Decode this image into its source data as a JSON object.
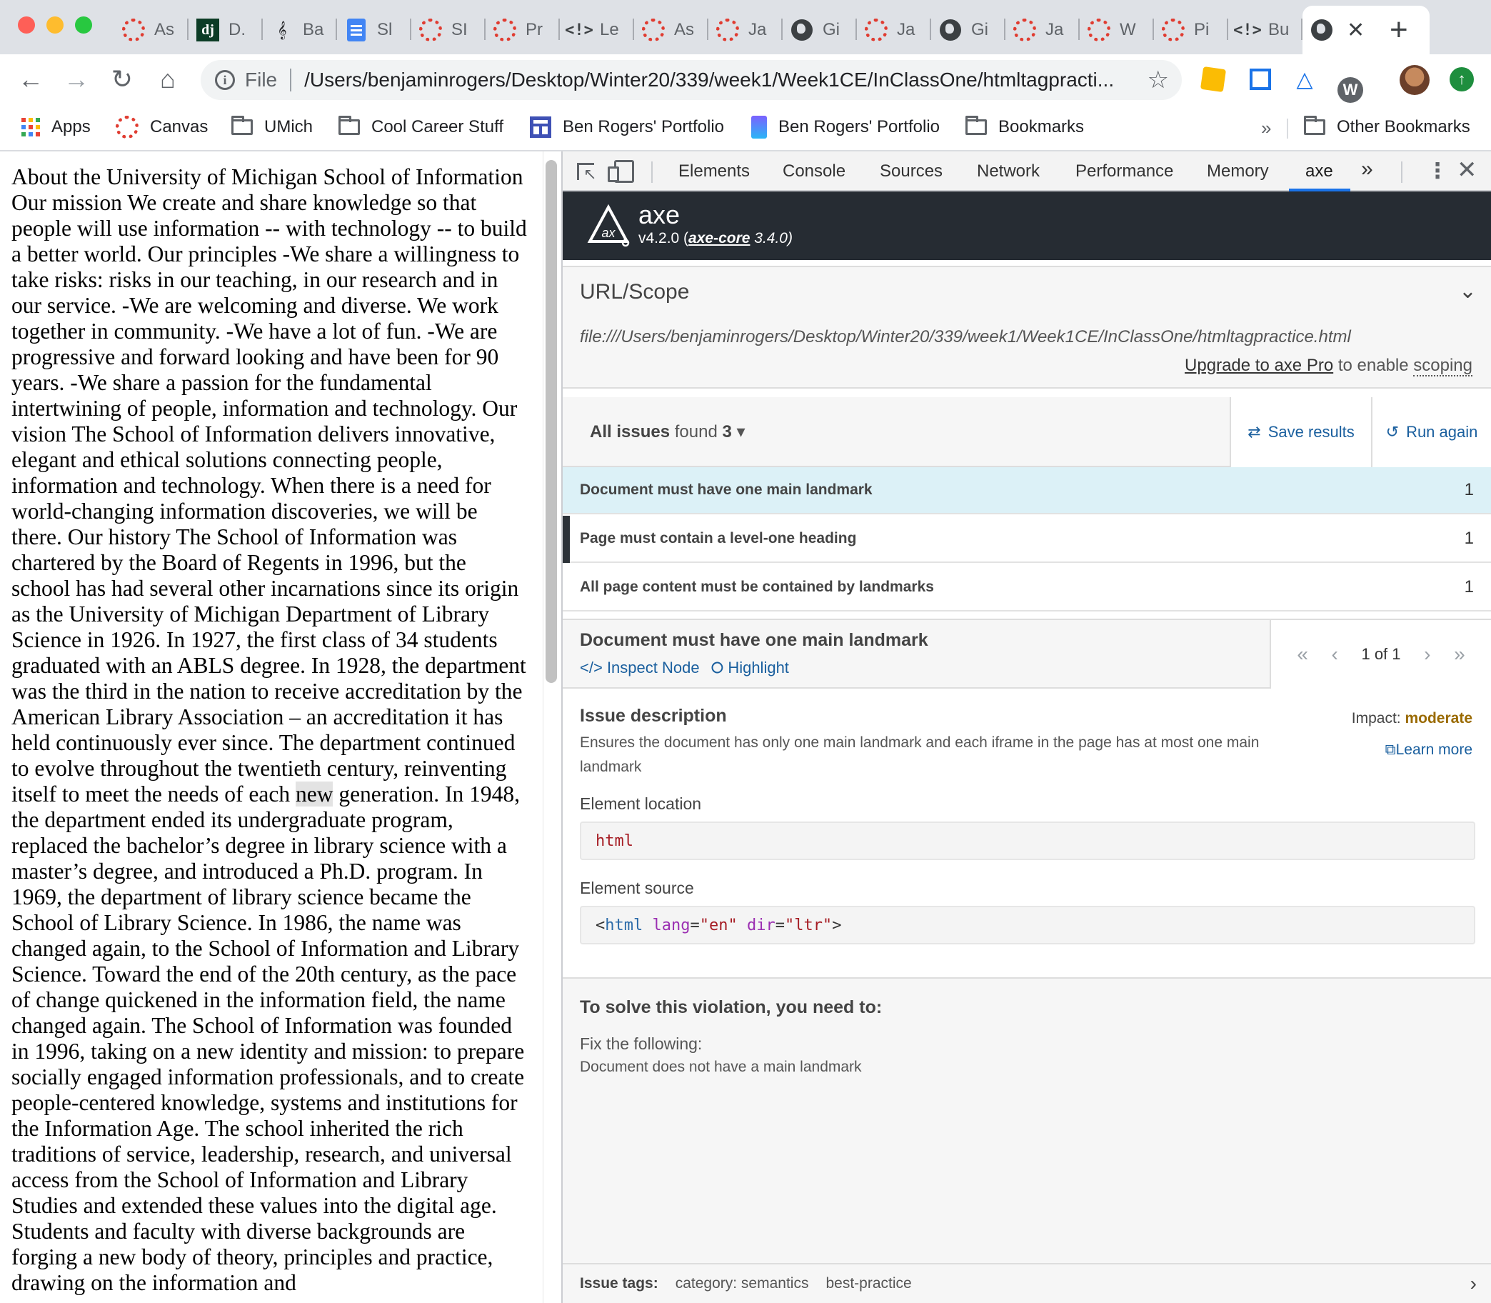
{
  "browser": {
    "tabs": [
      {
        "title": "As",
        "icon": "canvas-icon"
      },
      {
        "title": "D.",
        "icon": "django-icon"
      },
      {
        "title": "Ba",
        "icon": "music-icon"
      },
      {
        "title": "Sl",
        "icon": "google-docs-icon"
      },
      {
        "title": "SI",
        "icon": "canvas-icon"
      },
      {
        "title": "Pr",
        "icon": "canvas-icon"
      },
      {
        "title": "Le",
        "icon": "code-icon"
      },
      {
        "title": "As",
        "icon": "canvas-icon"
      },
      {
        "title": "Ja",
        "icon": "canvas-icon"
      },
      {
        "title": "Gi",
        "icon": "globe-icon"
      },
      {
        "title": "Ja",
        "icon": "canvas-icon"
      },
      {
        "title": "Gi",
        "icon": "globe-icon"
      },
      {
        "title": "Ja",
        "icon": "canvas-icon"
      },
      {
        "title": "W",
        "icon": "canvas-icon"
      },
      {
        "title": "Pi",
        "icon": "canvas-icon"
      },
      {
        "title": "Bu",
        "icon": "code-icon"
      }
    ],
    "active_tab_icon": "globe-icon",
    "new_tab_label": "+",
    "address": {
      "scheme_label": "File",
      "url": "/Users/benjaminrogers/Desktop/Winter20/339/week1/Week1CE/InClassOne/htmltagpracti..."
    },
    "bookmarks": [
      {
        "label": "Apps",
        "icon": "apps-grid-icon"
      },
      {
        "label": "Canvas",
        "icon": "canvas-icon"
      },
      {
        "label": "UMich",
        "icon": "folder-icon"
      },
      {
        "label": "Cool Career Stuff",
        "icon": "folder-icon"
      },
      {
        "label": "Ben Rogers' Portfolio",
        "icon": "portfolio-icon"
      },
      {
        "label": "Ben Rogers' Portfolio",
        "icon": "portfolio-alt-icon"
      },
      {
        "label": "Bookmarks",
        "icon": "folder-icon"
      }
    ],
    "bookmarks_overflow": "»",
    "other_bookmarks": "Other Bookmarks"
  },
  "page": {
    "text_before": "About the University of Michigan School of Information Our mission We create and share knowledge so that people will use information -- with technology -- to build a better world. Our principles -We share a willingness to take risks: risks in our teaching, in our research and in our service. -We are welcoming and diverse. We work together in community. -We have a lot of fun. -We are progressive and forward looking and have been for 90 years. -We share a passion for the fundamental intertwining of people, information and technology. Our vision The School of Information delivers innovative, elegant and ethical solutions connecting people, information and technology. When there is a need for world-changing information discoveries, we will be there. Our history The School of Information was chartered by the Board of Regents in 1996, but the school has had several other incarnations since its origin as the University of Michigan Department of Library Science in 1926. In 1927, the first class of 34 students graduated with an ABLS degree. In 1928, the department was the third in the nation to receive accreditation by the American Library Association – an accreditation it has held continuously ever since. The department continued to evolve throughout the twentieth century, reinventing itself to meet the needs of each",
    "text_highlight": "new",
    "text_after": "generation. In 1948, the department ended its undergraduate program, replaced the bachelor’s degree in library science with a master’s degree, and introduced a Ph.D. program. In 1969, the department of library science became the School of Library Science. In 1986, the name was changed again, to the School of Information and Library Science. Toward the end of the 20th century, as the pace of change quickened in the information field, the name changed again. The School of Information was founded in 1996, taking on a new identity and mission: to prepare socially engaged information professionals, and to create people-centered knowledge, systems and institutions for the Information Age. The school inherited the rich traditions of service, leadership, research, and universal access from the School of Information and Library Studies and extended these values into the digital age. Students and faculty with diverse backgrounds are forging a new body of theory, principles and practice, drawing on the information and"
  },
  "devtools": {
    "tabs": [
      "Elements",
      "Console",
      "Sources",
      "Network",
      "Performance",
      "Memory",
      "axe"
    ],
    "active_tab": "axe",
    "more_tabs": "»",
    "axe": {
      "name": "axe",
      "version_prefix": "v4.2.0 (",
      "core_link": "axe-core",
      "core_version": " 3.4.0)",
      "scope_title": "URL/Scope",
      "scope_url": "file:///Users/benjaminrogers/Desktop/Winter20/339/week1/Week1CE/InClassOne/htmltagpractice.html",
      "upgrade_link": "Upgrade to axe Pro",
      "upgrade_mid": " to enable ",
      "upgrade_scoping": "scoping",
      "issues_bold": "All issues",
      "issues_found": " found ",
      "issues_count": "3",
      "save_results": "Save results",
      "run_again": "Run again",
      "issues": [
        {
          "title": "Document must have one main landmark",
          "count": "1"
        },
        {
          "title": "Page must contain a level-one heading",
          "count": "1"
        },
        {
          "title": "All page content must be contained by landmarks",
          "count": "1"
        }
      ],
      "detail": {
        "title": "Document must have one main landmark",
        "inspect_node": "Inspect Node",
        "highlight": "Highlight",
        "pager": "1 of 1",
        "desc_title": "Issue description",
        "desc_text": "Ensures the document has only one main landmark and each iframe in the page has at most one main landmark",
        "impact_label": "Impact: ",
        "impact_value": "moderate",
        "learn_more": "Learn more",
        "location_label": "Element location",
        "location_value": "html",
        "source_label": "Element source",
        "source": {
          "open": "<",
          "tag": "html",
          "attr1": "lang",
          "val1": "\"en\"",
          "attr2": "dir",
          "val2": "\"ltr\"",
          "close": ">"
        },
        "solve_title": "To solve this violation, you need to:",
        "fix_label": "Fix the following:",
        "fix_item": "Document does not have a main landmark",
        "tags_label": "Issue tags:",
        "tags": [
          "category: semantics",
          "best-practice"
        ]
      }
    }
  }
}
